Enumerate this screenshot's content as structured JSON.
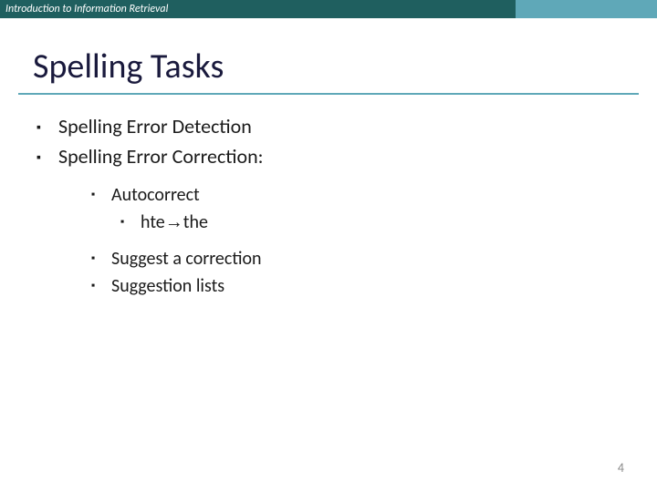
{
  "header": {
    "course": "Introduction to Information Retrieval"
  },
  "title": "Spelling Tasks",
  "bullets": {
    "b1": "Spelling Error Detection",
    "b2": "Spelling Error Correction:",
    "s1": "Autocorrect",
    "ss1_from": "hte",
    "ss1_to": "the",
    "s2": "Suggest a correction",
    "s3": "Suggestion lists"
  },
  "page_number": "4"
}
